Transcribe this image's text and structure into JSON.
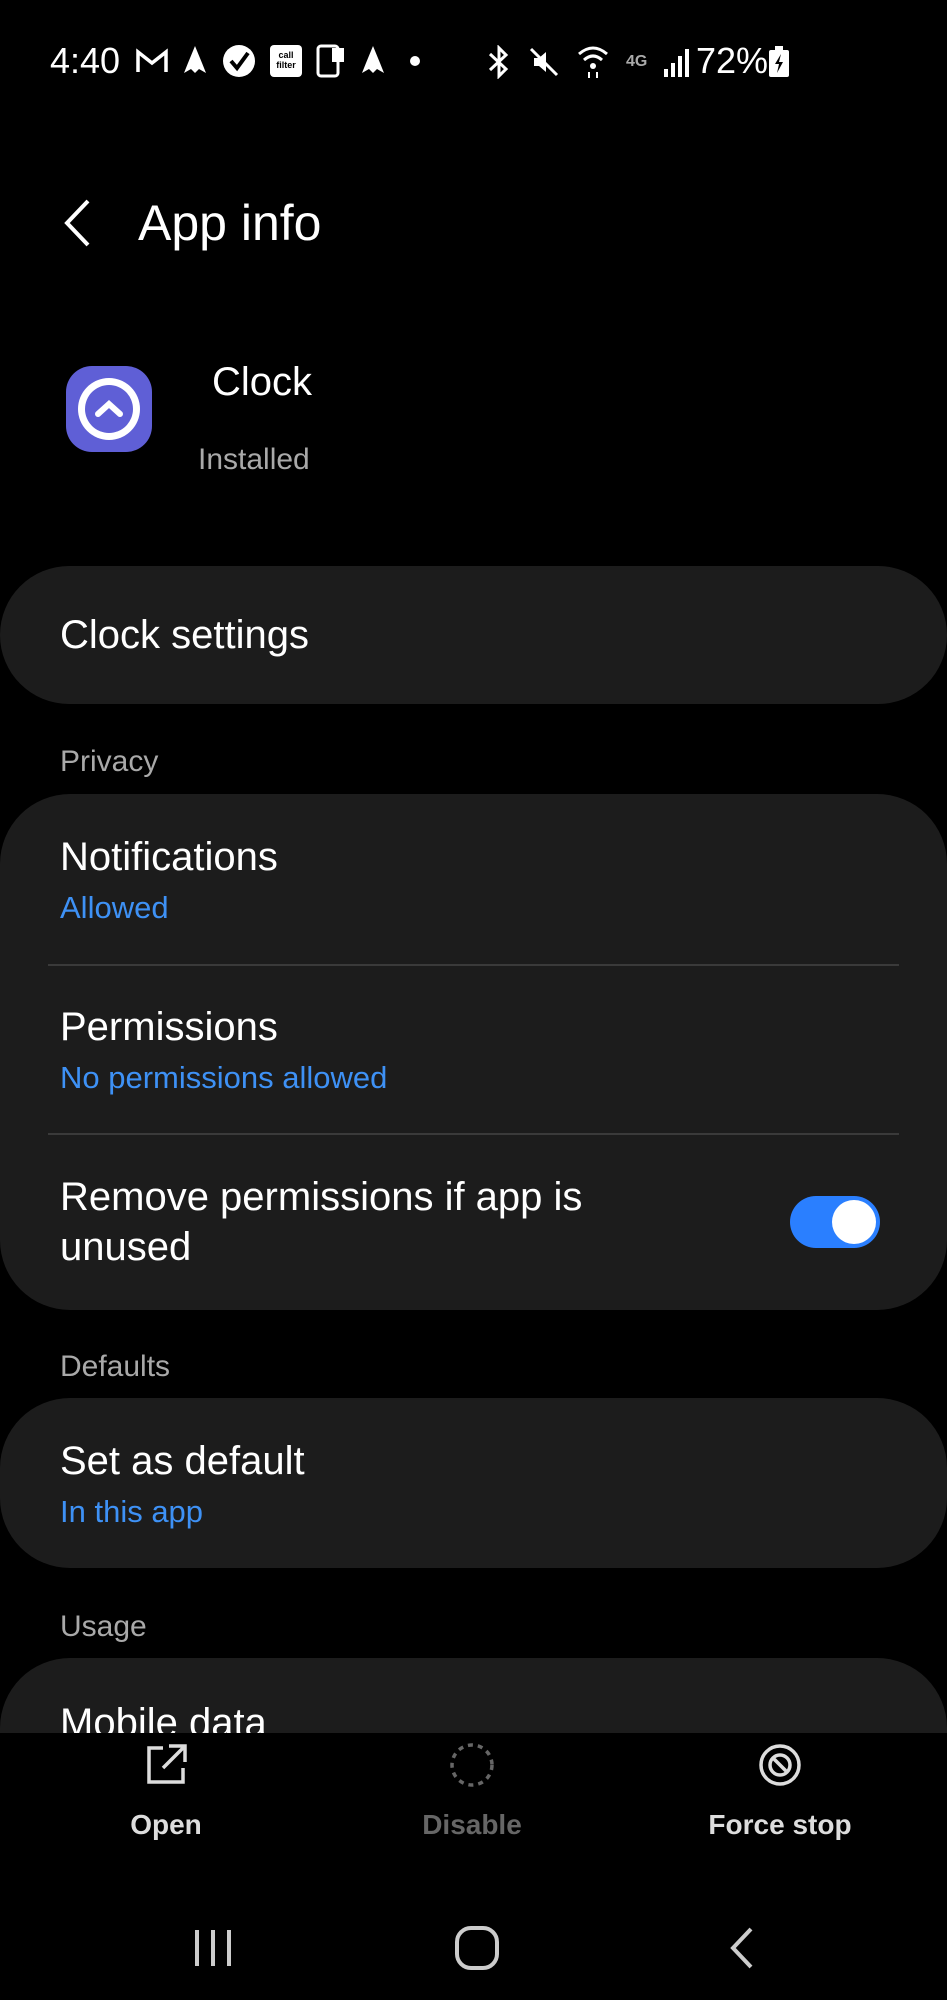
{
  "status_bar": {
    "time": "4:40",
    "battery": "72%",
    "icons": [
      "gmail-icon",
      "rocket-icon",
      "check-icon",
      "call-filter-icon",
      "sim-icon",
      "rocket-icon",
      "dot-icon",
      "bluetooth-icon",
      "mute-icon",
      "wifi-icon",
      "4g-icon",
      "signal-icon",
      "battery-icon"
    ],
    "call_filter_text": "call filter",
    "network_text": "4G"
  },
  "header": {
    "title": "App info"
  },
  "app": {
    "name": "Clock",
    "status": "Installed",
    "icon_color": "#5f5fd6"
  },
  "settings": {
    "clock_settings": "Clock settings"
  },
  "privacy": {
    "label": "Privacy",
    "notifications": {
      "title": "Notifications",
      "value": "Allowed"
    },
    "permissions": {
      "title": "Permissions",
      "value": "No permissions allowed"
    },
    "remove_unused": {
      "title_line1": "Remove permissions if app is",
      "title_line2": "unused",
      "enabled": true
    }
  },
  "defaults": {
    "label": "Defaults",
    "set_default": {
      "title": "Set as default",
      "value": "In this app"
    }
  },
  "usage": {
    "label": "Usage",
    "mobile_data": {
      "title": "Mobile data"
    }
  },
  "actions": {
    "open": "Open",
    "disable": "Disable",
    "force_stop": "Force stop"
  },
  "colors": {
    "accent": "#3e91f5",
    "toggle": "#2a7fff",
    "card": "#1c1c1c"
  }
}
